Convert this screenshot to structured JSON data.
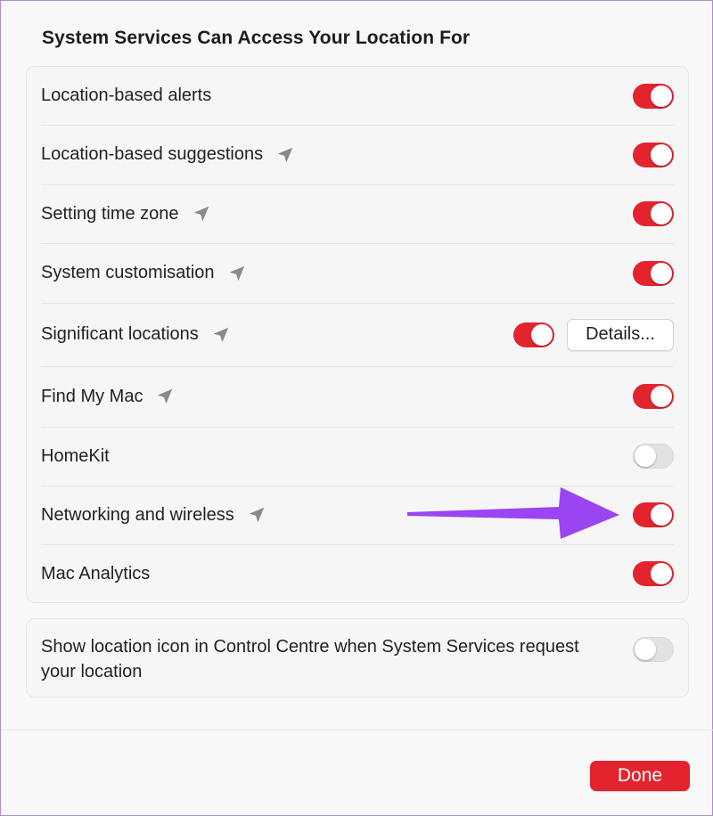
{
  "header": {
    "title": "System Services Can Access Your Location For"
  },
  "services": [
    {
      "label": "Location-based alerts",
      "location_icon": false,
      "enabled": true
    },
    {
      "label": "Location-based suggestions",
      "location_icon": true,
      "enabled": true
    },
    {
      "label": "Setting time zone",
      "location_icon": true,
      "enabled": true
    },
    {
      "label": "System customisation",
      "location_icon": true,
      "enabled": true
    },
    {
      "label": "Significant locations",
      "location_icon": true,
      "enabled": true,
      "details_label": "Details..."
    },
    {
      "label": "Find My Mac",
      "location_icon": true,
      "enabled": true
    },
    {
      "label": "HomeKit",
      "location_icon": false,
      "enabled": false
    },
    {
      "label": "Networking and wireless",
      "location_icon": true,
      "enabled": true
    },
    {
      "label": "Mac Analytics",
      "location_icon": false,
      "enabled": true
    }
  ],
  "control_centre": {
    "label": "Show location icon in Control Centre when System Services request your location",
    "enabled": false
  },
  "footer": {
    "done_label": "Done"
  },
  "colors": {
    "accent": "#e3242f",
    "annotation_arrow": "#9b45f2",
    "location_icon": "#8a8a8a"
  },
  "icons": {
    "location": "location-arrow-icon",
    "annotation": "arrow-annotation"
  }
}
